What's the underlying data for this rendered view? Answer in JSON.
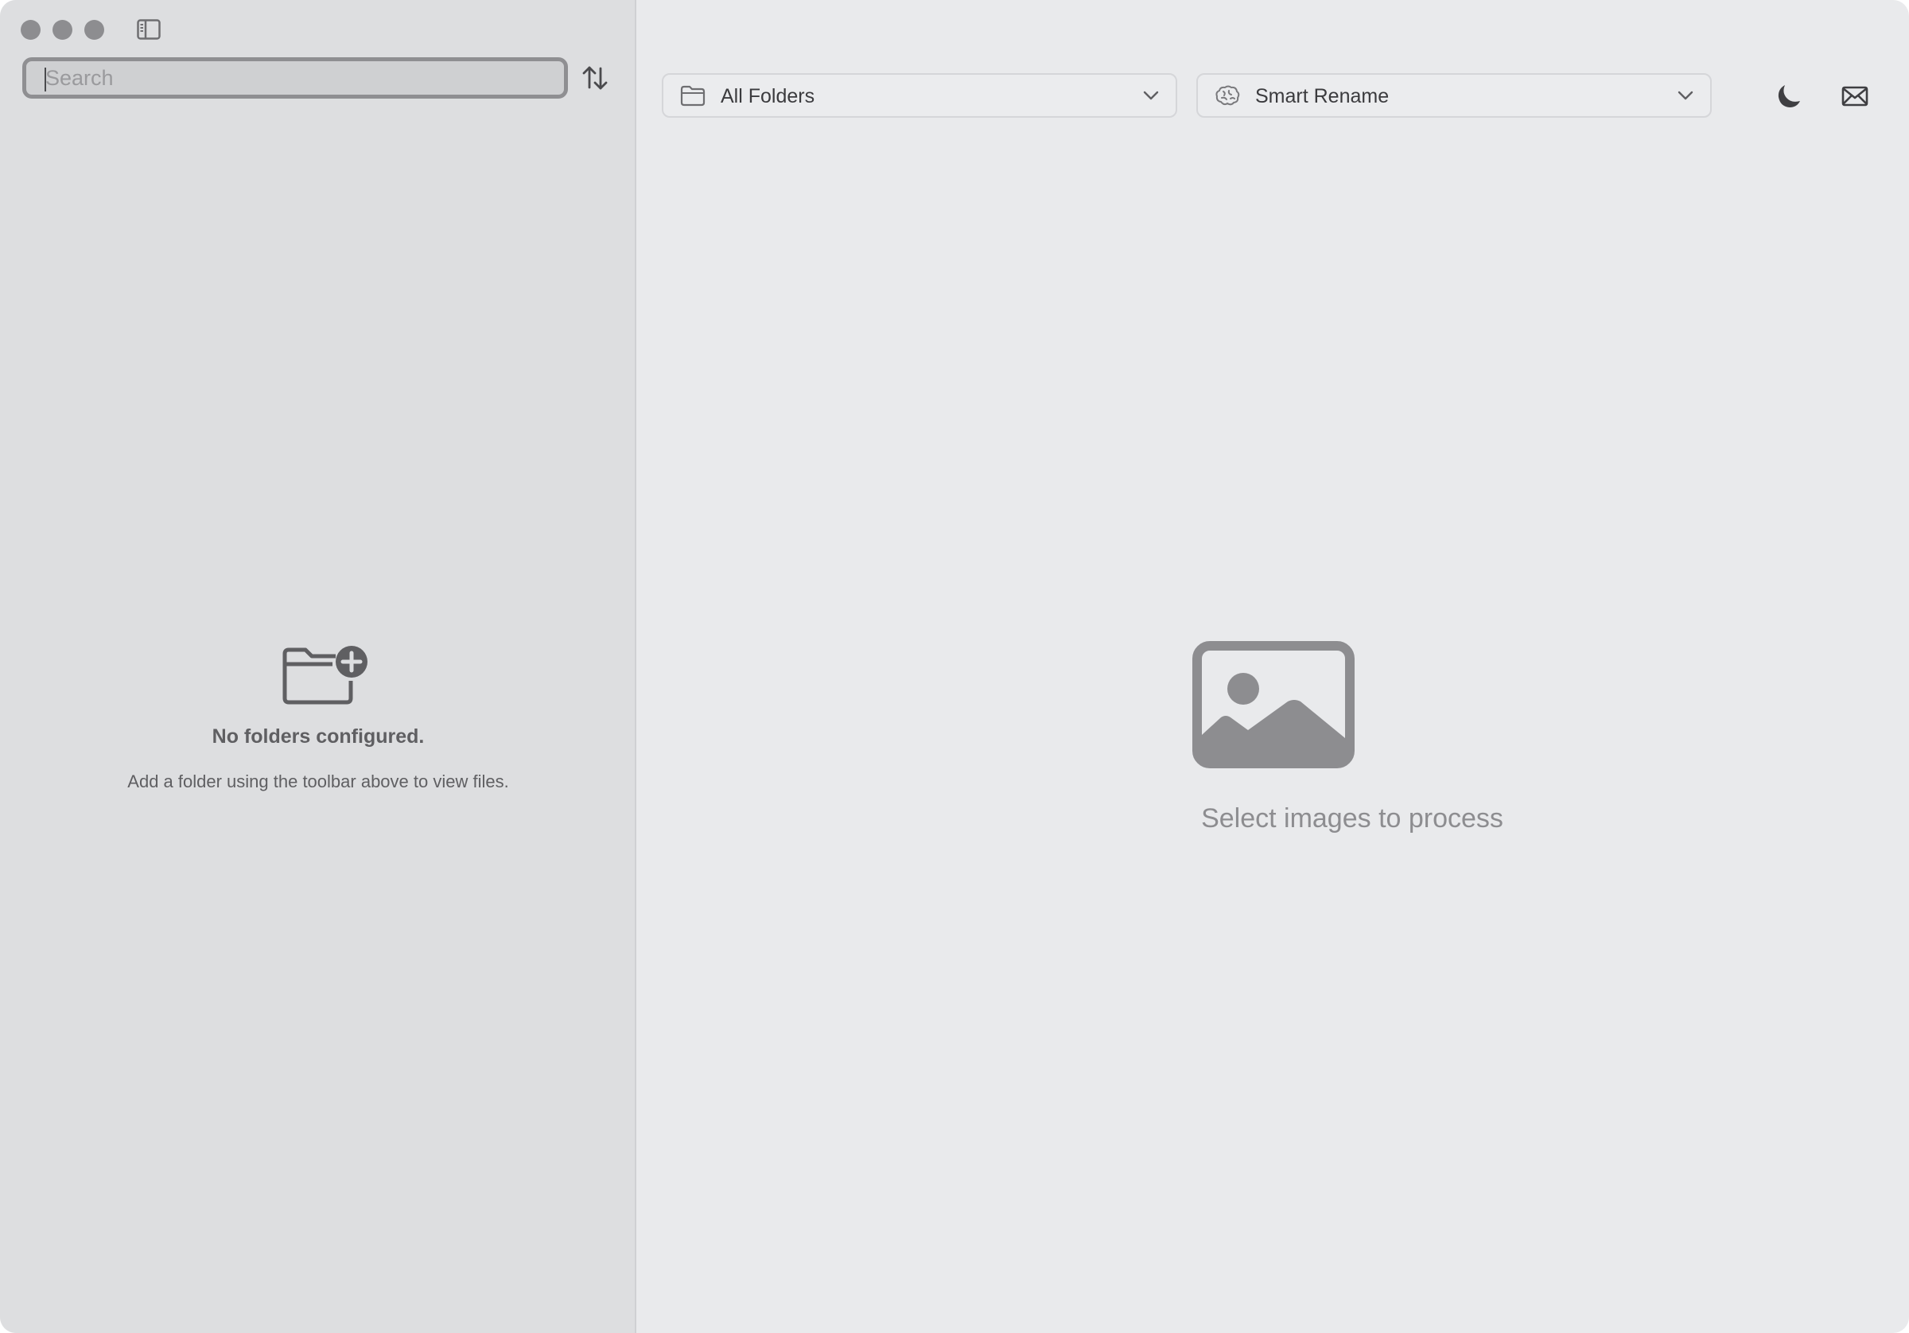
{
  "window": {
    "traffic_lights": [
      "close",
      "minimize",
      "zoom"
    ]
  },
  "sidebar": {
    "toggle_icon": "sidebar-icon",
    "search": {
      "placeholder": "Search",
      "value": ""
    },
    "sort_icon": "arrow-up-down-icon",
    "empty_state": {
      "icon": "folder-plus-icon",
      "title": "No folders configured.",
      "subtitle": "Add a folder using the toolbar above to view files."
    }
  },
  "toolbar": {
    "folder_dropdown": {
      "icon": "folder-icon",
      "label": "All Folders"
    },
    "mode_dropdown": {
      "icon": "brain-icon",
      "label": "Smart Rename"
    },
    "dark_mode_icon": "moon-icon",
    "mail_icon": "envelope-icon"
  },
  "main": {
    "empty_state": {
      "icon": "photo-icon",
      "message": "Select images to process"
    }
  },
  "colors": {
    "sidebar_bg": "#dddee0",
    "main_bg": "#e9eaec",
    "icon_gray": "#8d8d90",
    "text_dark": "#5f5f62"
  }
}
